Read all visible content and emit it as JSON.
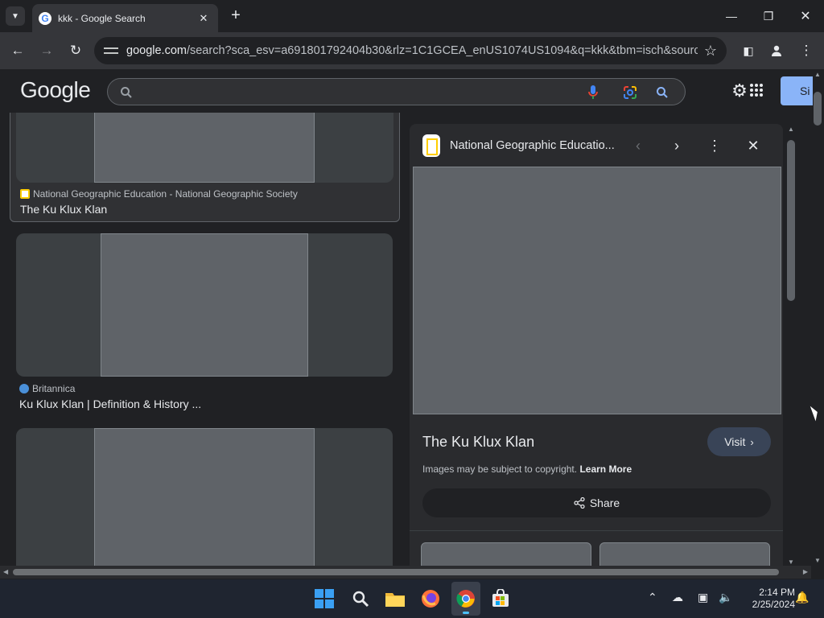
{
  "browser": {
    "tab_title": "kkk - Google Search",
    "url_host": "google.com",
    "url_rest": "/search?sca_esv=a691801792404b30&rlz=1C1GCEA_enUS1074US1094&q=kkk&tbm=isch&source=l...",
    "icons": [
      "tab-list-icon",
      "google-favicon-icon",
      "close-tab-icon",
      "new-tab-icon",
      "minimize-icon",
      "maximize-icon",
      "close-window-icon",
      "back-icon",
      "forward-icon",
      "reload-icon",
      "site-info-icon",
      "bookmark-star-icon",
      "side-panel-icon",
      "profile-icon",
      "more-icon"
    ]
  },
  "google": {
    "logo": "Google",
    "signin_label": "Si"
  },
  "results": [
    {
      "source": "National Geographic Education - National Geographic Society",
      "title": "The Ku Klux Klan",
      "source_color": "#ffce00"
    },
    {
      "source": "Britannica",
      "title": "Ku Klux Klan | Definition & History ...",
      "source_color": "#4a90d9"
    },
    {
      "source": "",
      "title": ""
    }
  ],
  "panel": {
    "source": "National Geographic Educatio...",
    "title": "The Ku Klux Klan",
    "visit_label": "Visit",
    "copyright_text": "Images may be subject to copyright.",
    "learn_more": "Learn More",
    "share_label": "Share"
  },
  "taskbar": {
    "time": "2:14 PM",
    "date": "2/25/2024"
  },
  "colors": {
    "accent": "#8ab4f8",
    "background": "#202124",
    "surface": "#303134",
    "taskbar": "#1f2530"
  }
}
